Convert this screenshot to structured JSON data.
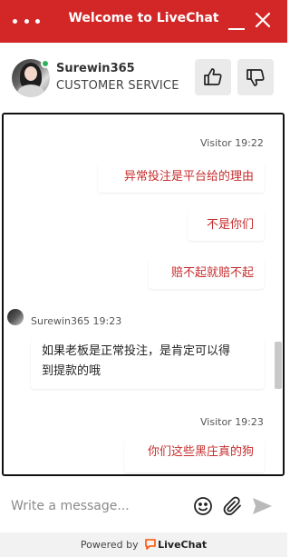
{
  "header": {
    "title": "Welcome to LiveChat",
    "menu_icon": "more-dots-icon",
    "minimize_icon": "minimize-icon",
    "close_icon": "close-icon",
    "bg_color": "#d32727"
  },
  "agent": {
    "name": "Surewin365",
    "role": "CUSTOMER SERVICE",
    "status_color": "#2fb15d"
  },
  "messages": {
    "visitor_meta_1": "Visitor 19:22",
    "visitor_msg_1": "异常投注是平台给的理由",
    "visitor_msg_2": "不是你们",
    "visitor_msg_3": "赔不起就赔不起",
    "agent_meta": "Surewin365 19:23",
    "agent_msg_line1": "如果老板是正常投注，是肯定可以得",
    "agent_msg_line2": "到提款的哦",
    "visitor_meta_2": "Visitor 19:23",
    "visitor_msg_4": "你们这些黑庄真的狗",
    "visitor_text_color": "#c62d2d"
  },
  "composer": {
    "placeholder": "Write a message...",
    "emoji_icon": "emoji-icon",
    "attach_icon": "paperclip-icon",
    "send_icon": "send-icon"
  },
  "footer": {
    "powered_by": "Powered by",
    "brand": "LiveChat",
    "brand_icon": "livechat-logo-icon",
    "brand_color": "#ff5100"
  }
}
